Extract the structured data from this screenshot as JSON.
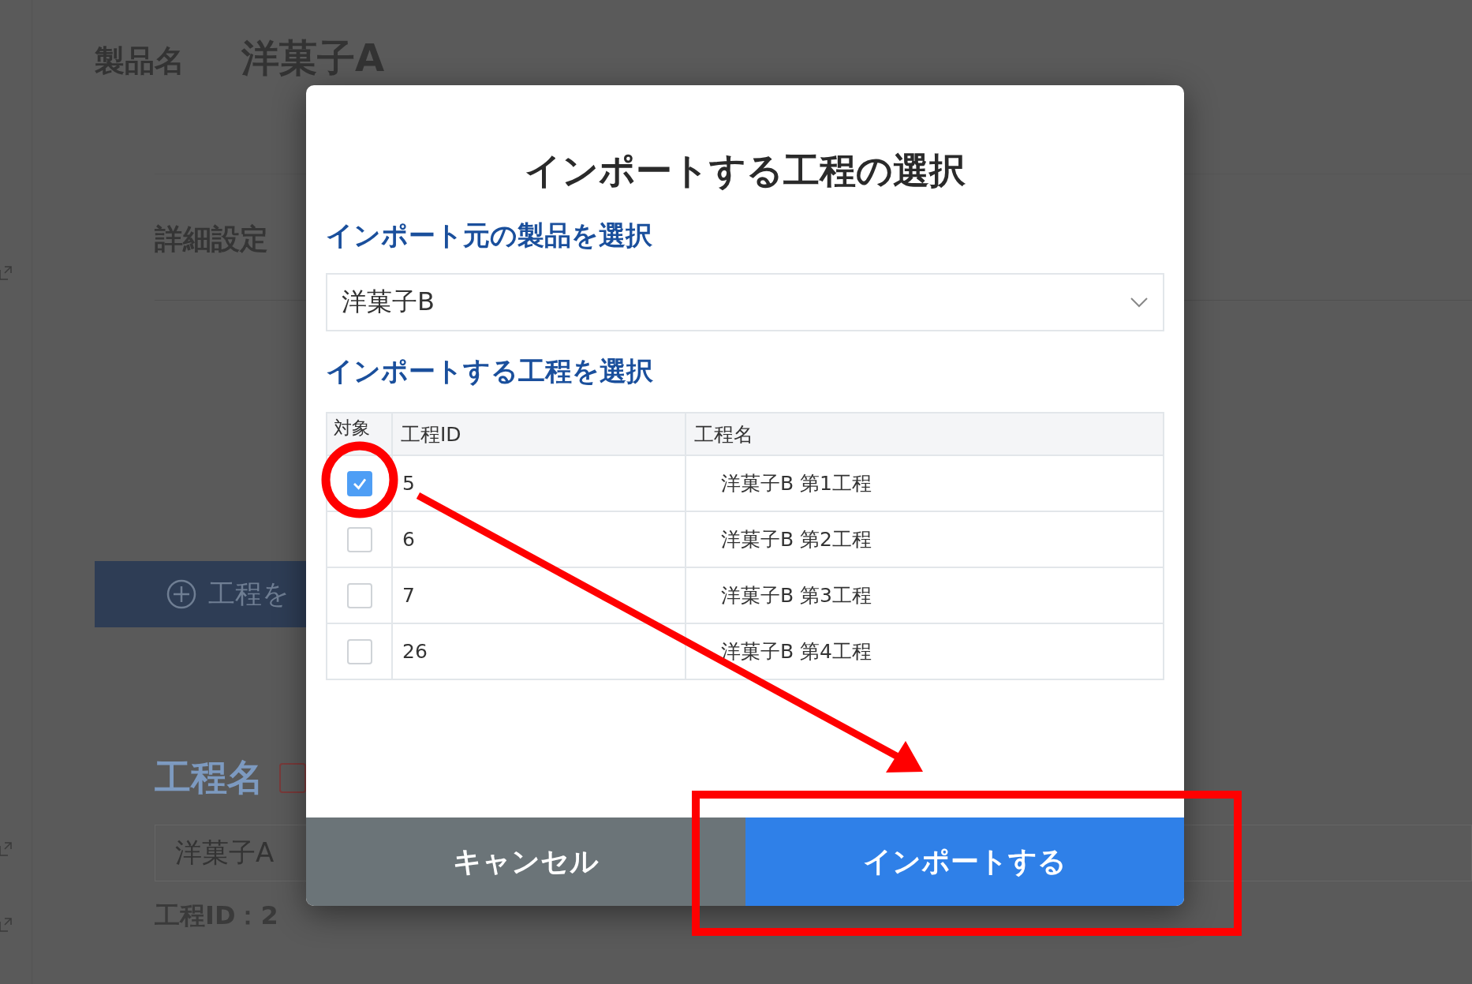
{
  "page": {
    "product_name_label": "製品名",
    "product_name": "洋菓子A",
    "detail_heading": "詳細設定",
    "add_process_button": "工程を",
    "process_name_heading": "工程名",
    "process_name_value": "洋菓子A",
    "process_id": "工程ID：2"
  },
  "dialog": {
    "title": "インポートする工程の選択",
    "source_label": "インポート元の製品を選択",
    "source_select": {
      "value": "洋菓子B"
    },
    "process_label": "インポートする工程を選択",
    "table": {
      "columns": [
        "対象",
        "工程ID",
        "工程名"
      ],
      "rows": [
        {
          "checked": true,
          "id": "5",
          "name": "洋菓子B 第1工程"
        },
        {
          "checked": false,
          "id": "6",
          "name": "洋菓子B 第2工程"
        },
        {
          "checked": false,
          "id": "7",
          "name": "洋菓子B 第3工程"
        },
        {
          "checked": false,
          "id": "26",
          "name": "洋菓子B 第4工程"
        }
      ]
    },
    "buttons": [
      {
        "label": "キャンセル",
        "kind": "secondary"
      },
      {
        "label": "インポートする",
        "kind": "primary"
      }
    ]
  }
}
